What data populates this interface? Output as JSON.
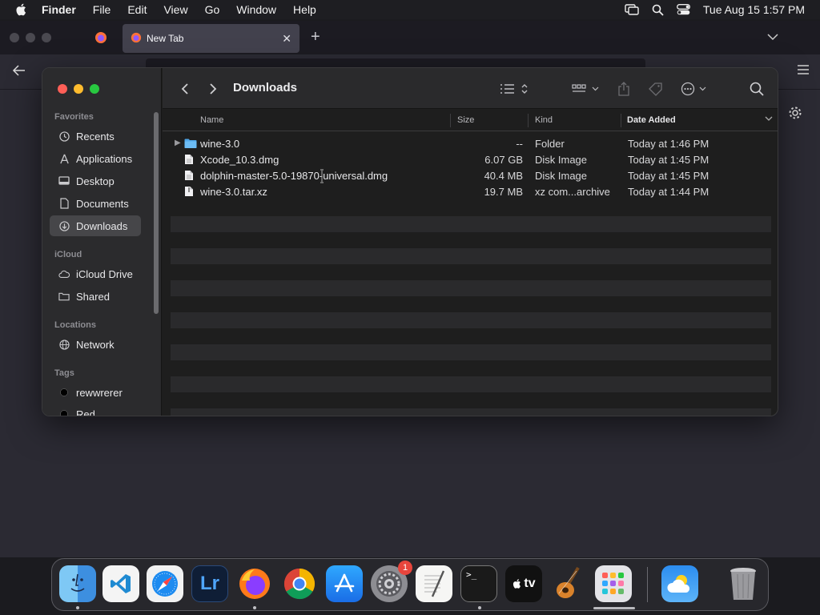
{
  "menubar": {
    "items": [
      "Finder",
      "File",
      "Edit",
      "View",
      "Go",
      "Window",
      "Help"
    ],
    "clock": "Tue Aug 15  1:57 PM"
  },
  "browser": {
    "tab_title": "New Tab"
  },
  "finder": {
    "title": "Downloads",
    "sidebar": {
      "favorites_header": "Favorites",
      "favorites": [
        {
          "label": "Recents",
          "icon": "clock-icon"
        },
        {
          "label": "Applications",
          "icon": "applications-icon"
        },
        {
          "label": "Desktop",
          "icon": "desktop-icon"
        },
        {
          "label": "Documents",
          "icon": "document-icon"
        },
        {
          "label": "Downloads",
          "icon": "download-icon",
          "selected": true
        }
      ],
      "icloud_header": "iCloud",
      "icloud": [
        {
          "label": "iCloud Drive",
          "icon": "cloud-icon"
        },
        {
          "label": "Shared",
          "icon": "shared-folder-icon"
        }
      ],
      "locations_header": "Locations",
      "locations": [
        {
          "label": "Network",
          "icon": "globe-icon"
        }
      ],
      "tags_header": "Tags",
      "tags": [
        {
          "label": "rewwrerer",
          "color": "#000000"
        },
        {
          "label": "Red",
          "color": "#000000"
        }
      ]
    },
    "columns": {
      "name": "Name",
      "size": "Size",
      "kind": "Kind",
      "date": "Date Added"
    },
    "files": [
      {
        "name": "wine-3.0",
        "size": "--",
        "kind": "Folder",
        "date": "Today at 1:46 PM",
        "type": "folder"
      },
      {
        "name": "Xcode_10.3.dmg",
        "size": "6.07 GB",
        "kind": "Disk Image",
        "date": "Today at 1:45 PM",
        "type": "file"
      },
      {
        "name": "dolphin-master-5.0-19870-universal.dmg",
        "size": "40.4 MB",
        "kind": "Disk Image",
        "date": "Today at 1:45 PM",
        "type": "file"
      },
      {
        "name": "wine-3.0.tar.xz",
        "size": "19.7 MB",
        "kind": "xz com...archive",
        "date": "Today at 1:44 PM",
        "type": "file"
      }
    ]
  },
  "dock": {
    "apps": [
      "Finder",
      "Visual Studio Code",
      "Safari",
      "Lightroom",
      "Firefox",
      "Chrome",
      "App Store",
      "System Settings",
      "TextEdit",
      "Terminal",
      "Apple TV",
      "GarageBand",
      "Launchpad",
      "Weather",
      "Trash"
    ],
    "lightroom_label": "Lr",
    "tv_label": "tv",
    "settings_badge": "1",
    "terminal_prompt": ">_"
  },
  "colors": {
    "accent_folder": "#4fa6e8",
    "close": "#ff5f57",
    "minimize": "#febc2e",
    "zoom": "#28c840"
  }
}
